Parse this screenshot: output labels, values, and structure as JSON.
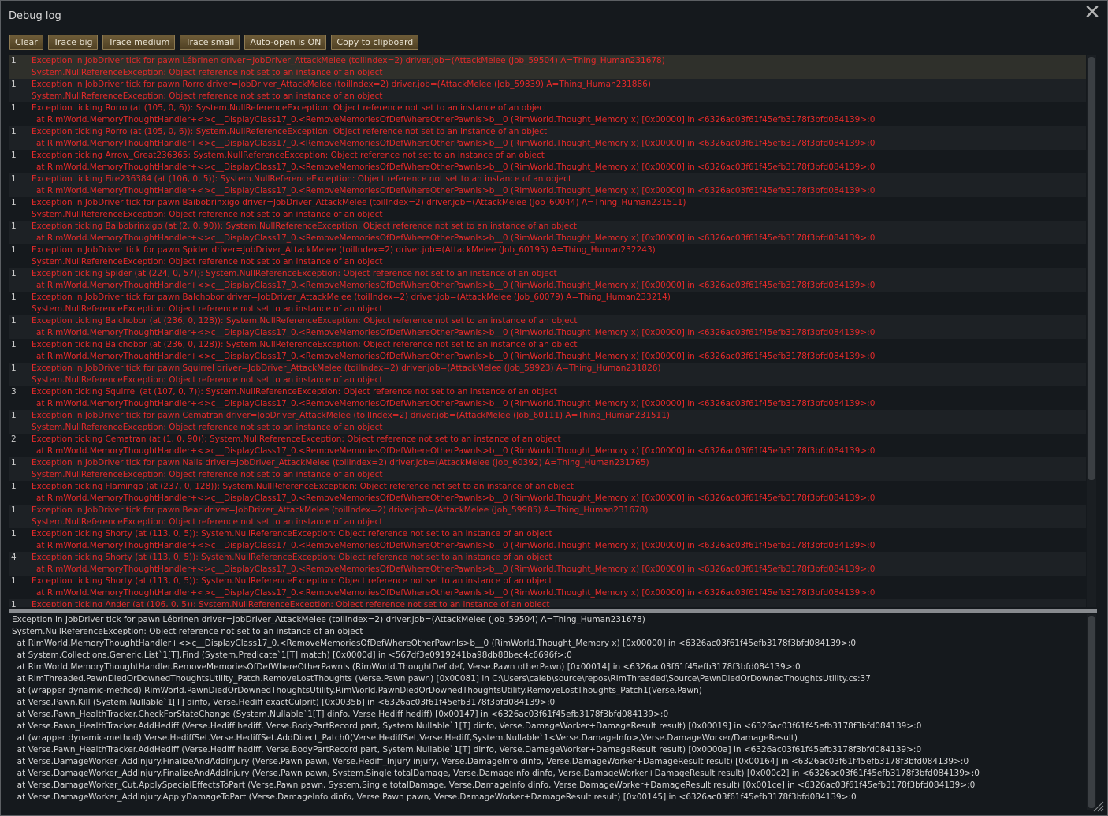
{
  "window": {
    "title": "Debug log",
    "close_glyph": "✕"
  },
  "toolbar": [
    "Clear",
    "Trace big",
    "Trace medium",
    "Trace small",
    "Auto-open is ON",
    "Copy to clipboard"
  ],
  "log_entries": [
    {
      "count": "1",
      "l1": "Exception in JobDriver tick for pawn Lébrinen driver=JobDriver_AttackMelee (toilIndex=2) driver.job=(AttackMelee (Job_59504) A=Thing_Human231678)",
      "l2": "System.NullReferenceException: Object reference not set to an instance of an object"
    },
    {
      "count": "1",
      "l1": "Exception in JobDriver tick for pawn Rorro driver=JobDriver_AttackMelee (toilIndex=2) driver.job=(AttackMelee (Job_59839) A=Thing_Human231886)",
      "l2": "System.NullReferenceException: Object reference not set to an instance of an object"
    },
    {
      "count": "1",
      "l1": "Exception ticking Rorro (at (105, 0, 6)): System.NullReferenceException: Object reference not set to an instance of an object",
      "l2": "at RimWorld.MemoryThoughtHandler+<>c__DisplayClass17_0.<RemoveMemoriesOfDefWhereOtherPawnIs>b__0 (RimWorld.Thought_Memory x) [0x00000] in <6326ac03f61f45efb3178f3bfd084139>:0",
      "indent": true
    },
    {
      "count": "1",
      "l1": "Exception ticking Rorro (at (105, 0, 6)): System.NullReferenceException: Object reference not set to an instance of an object",
      "l2": "at RimWorld.MemoryThoughtHandler+<>c__DisplayClass17_0.<RemoveMemoriesOfDefWhereOtherPawnIs>b__0 (RimWorld.Thought_Memory x) [0x00000] in <6326ac03f61f45efb3178f3bfd084139>:0",
      "indent": true
    },
    {
      "count": "1",
      "l1": "Exception ticking Arrow_Great236365: System.NullReferenceException: Object reference not set to an instance of an object",
      "l2": "at RimWorld.MemoryThoughtHandler+<>c__DisplayClass17_0.<RemoveMemoriesOfDefWhereOtherPawnIs>b__0 (RimWorld.Thought_Memory x) [0x00000] in <6326ac03f61f45efb3178f3bfd084139>:0",
      "indent": true
    },
    {
      "count": "1",
      "l1": "Exception ticking Fire236384 (at (106, 0, 5)): System.NullReferenceException: Object reference not set to an instance of an object",
      "l2": "at RimWorld.MemoryThoughtHandler+<>c__DisplayClass17_0.<RemoveMemoriesOfDefWhereOtherPawnIs>b__0 (RimWorld.Thought_Memory x) [0x00000] in <6326ac03f61f45efb3178f3bfd084139>:0",
      "indent": true
    },
    {
      "count": "1",
      "l1": "Exception in JobDriver tick for pawn Baibobrinxigo driver=JobDriver_AttackMelee (toilIndex=2) driver.job=(AttackMelee (Job_60044) A=Thing_Human231511)",
      "l2": "System.NullReferenceException: Object reference not set to an instance of an object"
    },
    {
      "count": "1",
      "l1": "Exception ticking Baibobrinxigo (at (2, 0, 90)): System.NullReferenceException: Object reference not set to an instance of an object",
      "l2": "at RimWorld.MemoryThoughtHandler+<>c__DisplayClass17_0.<RemoveMemoriesOfDefWhereOtherPawnIs>b__0 (RimWorld.Thought_Memory x) [0x00000] in <6326ac03f61f45efb3178f3bfd084139>:0",
      "indent": true
    },
    {
      "count": "1",
      "l1": "Exception in JobDriver tick for pawn Spider driver=JobDriver_AttackMelee (toilIndex=2) driver.job=(AttackMelee (Job_60195) A=Thing_Human232243)",
      "l2": "System.NullReferenceException: Object reference not set to an instance of an object"
    },
    {
      "count": "1",
      "l1": "Exception ticking Spider (at (224, 0, 57)): System.NullReferenceException: Object reference not set to an instance of an object",
      "l2": "at RimWorld.MemoryThoughtHandler+<>c__DisplayClass17_0.<RemoveMemoriesOfDefWhereOtherPawnIs>b__0 (RimWorld.Thought_Memory x) [0x00000] in <6326ac03f61f45efb3178f3bfd084139>:0",
      "indent": true
    },
    {
      "count": "1",
      "l1": "Exception in JobDriver tick for pawn Balchobor driver=JobDriver_AttackMelee (toilIndex=2) driver.job=(AttackMelee (Job_60079) A=Thing_Human233214)",
      "l2": "System.NullReferenceException: Object reference not set to an instance of an object"
    },
    {
      "count": "1",
      "l1": "Exception ticking Balchobor (at (236, 0, 128)): System.NullReferenceException: Object reference not set to an instance of an object",
      "l2": "at RimWorld.MemoryThoughtHandler+<>c__DisplayClass17_0.<RemoveMemoriesOfDefWhereOtherPawnIs>b__0 (RimWorld.Thought_Memory x) [0x00000] in <6326ac03f61f45efb3178f3bfd084139>:0",
      "indent": true
    },
    {
      "count": "1",
      "l1": "Exception ticking Balchobor (at (236, 0, 128)): System.NullReferenceException: Object reference not set to an instance of an object",
      "l2": "at RimWorld.MemoryThoughtHandler+<>c__DisplayClass17_0.<RemoveMemoriesOfDefWhereOtherPawnIs>b__0 (RimWorld.Thought_Memory x) [0x00000] in <6326ac03f61f45efb3178f3bfd084139>:0",
      "indent": true
    },
    {
      "count": "1",
      "l1": "Exception in JobDriver tick for pawn Squirrel driver=JobDriver_AttackMelee (toilIndex=2) driver.job=(AttackMelee (Job_59923) A=Thing_Human231826)",
      "l2": "System.NullReferenceException: Object reference not set to an instance of an object"
    },
    {
      "count": "3",
      "l1": "Exception ticking Squirrel (at (107, 0, 7)): System.NullReferenceException: Object reference not set to an instance of an object",
      "l2": "at RimWorld.MemoryThoughtHandler+<>c__DisplayClass17_0.<RemoveMemoriesOfDefWhereOtherPawnIs>b__0 (RimWorld.Thought_Memory x) [0x00000] in <6326ac03f61f45efb3178f3bfd084139>:0",
      "indent": true
    },
    {
      "count": "1",
      "l1": "Exception in JobDriver tick for pawn Cematran driver=JobDriver_AttackMelee (toilIndex=2) driver.job=(AttackMelee (Job_60111) A=Thing_Human231511)",
      "l2": "System.NullReferenceException: Object reference not set to an instance of an object"
    },
    {
      "count": "2",
      "l1": "Exception ticking Cematran (at (1, 0, 90)): System.NullReferenceException: Object reference not set to an instance of an object",
      "l2": "at RimWorld.MemoryThoughtHandler+<>c__DisplayClass17_0.<RemoveMemoriesOfDefWhereOtherPawnIs>b__0 (RimWorld.Thought_Memory x) [0x00000] in <6326ac03f61f45efb3178f3bfd084139>:0",
      "indent": true
    },
    {
      "count": "1",
      "l1": "Exception in JobDriver tick for pawn Nails driver=JobDriver_AttackMelee (toilIndex=2) driver.job=(AttackMelee (Job_60392) A=Thing_Human231765)",
      "l2": "System.NullReferenceException: Object reference not set to an instance of an object"
    },
    {
      "count": "1",
      "l1": "Exception ticking Flamingo (at (237, 0, 128)): System.NullReferenceException: Object reference not set to an instance of an object",
      "l2": "at RimWorld.MemoryThoughtHandler+<>c__DisplayClass17_0.<RemoveMemoriesOfDefWhereOtherPawnIs>b__0 (RimWorld.Thought_Memory x) [0x00000] in <6326ac03f61f45efb3178f3bfd084139>:0",
      "indent": true
    },
    {
      "count": "1",
      "l1": "Exception in JobDriver tick for pawn Bear driver=JobDriver_AttackMelee (toilIndex=2) driver.job=(AttackMelee (Job_59985) A=Thing_Human231678)",
      "l2": "System.NullReferenceException: Object reference not set to an instance of an object"
    },
    {
      "count": "1",
      "l1": "Exception ticking Shorty (at (113, 0, 5)): System.NullReferenceException: Object reference not set to an instance of an object",
      "l2": "at RimWorld.MemoryThoughtHandler+<>c__DisplayClass17_0.<RemoveMemoriesOfDefWhereOtherPawnIs>b__0 (RimWorld.Thought_Memory x) [0x00000] in <6326ac03f61f45efb3178f3bfd084139>:0",
      "indent": true
    },
    {
      "count": "4",
      "l1": "Exception ticking Shorty (at (113, 0, 5)): System.NullReferenceException: Object reference not set to an instance of an object",
      "l2": "at RimWorld.MemoryThoughtHandler+<>c__DisplayClass17_0.<RemoveMemoriesOfDefWhereOtherPawnIs>b__0 (RimWorld.Thought_Memory x) [0x00000] in <6326ac03f61f45efb3178f3bfd084139>:0",
      "indent": true
    },
    {
      "count": "1",
      "l1": "Exception ticking Shorty (at (113, 0, 5)): System.NullReferenceException: Object reference not set to an instance of an object",
      "l2": "at RimWorld.MemoryThoughtHandler+<>c__DisplayClass17_0.<RemoveMemoriesOfDefWhereOtherPawnIs>b__0 (RimWorld.Thought_Memory x) [0x00000] in <6326ac03f61f45efb3178f3bfd084139>:0",
      "indent": true
    },
    {
      "count": "1",
      "l1": "Exception ticking Ander (at (106, 0, 5)): System.NullReferenceException: Object reference not set to an instance of an object",
      "l2": ""
    }
  ],
  "detail_lines": [
    "Exception in JobDriver tick for pawn Lébrinen driver=JobDriver_AttackMelee (toilIndex=2) driver.job=(AttackMelee (Job_59504) A=Thing_Human231678)",
    "System.NullReferenceException: Object reference not set to an instance of an object",
    "  at RimWorld.MemoryThoughtHandler+<>c__DisplayClass17_0.<RemoveMemoriesOfDefWhereOtherPawnIs>b__0 (RimWorld.Thought_Memory x) [0x00000] in <6326ac03f61f45efb3178f3bfd084139>:0",
    "  at System.Collections.Generic.List`1[T].Find (System.Predicate`1[T] match) [0x0000d] in <567df3e0919241ba98db88bec4c6696f>:0",
    "  at RimWorld.MemoryThoughtHandler.RemoveMemoriesOfDefWhereOtherPawnIs (RimWorld.ThoughtDef def, Verse.Pawn otherPawn) [0x00014] in <6326ac03f61f45efb3178f3bfd084139>:0",
    "  at RimThreaded.PawnDiedOrDownedThoughtsUtility_Patch.RemoveLostThoughts (Verse.Pawn pawn) [0x00081] in C:\\Users\\caleb\\source\\repos\\RimThreaded\\Source\\PawnDiedOrDownedThoughtsUtility.cs:37",
    "  at (wrapper dynamic-method) RimWorld.PawnDiedOrDownedThoughtsUtility.RimWorld.PawnDiedOrDownedThoughtsUtility.RemoveLostThoughts_Patch1(Verse.Pawn)",
    "  at Verse.Pawn.Kill (System.Nullable`1[T] dinfo, Verse.Hediff exactCulprit) [0x0035b] in <6326ac03f61f45efb3178f3bfd084139>:0",
    "  at Verse.Pawn_HealthTracker.CheckForStateChange (System.Nullable`1[T] dinfo, Verse.Hediff hediff) [0x00147] in <6326ac03f61f45efb3178f3bfd084139>:0",
    "  at Verse.Pawn_HealthTracker.AddHediff (Verse.Hediff hediff, Verse.BodyPartRecord part, System.Nullable`1[T] dinfo, Verse.DamageWorker+DamageResult result) [0x00019] in <6326ac03f61f45efb3178f3bfd084139>:0",
    "  at (wrapper dynamic-method) Verse.HediffSet.Verse.HediffSet.AddDirect_Patch0(Verse.HediffSet,Verse.Hediff,System.Nullable`1<Verse.DamageInfo>,Verse.DamageWorker/DamageResult)",
    "  at Verse.Pawn_HealthTracker.AddHediff (Verse.Hediff hediff, Verse.BodyPartRecord part, System.Nullable`1[T] dinfo, Verse.DamageWorker+DamageResult result) [0x0000a] in <6326ac03f61f45efb3178f3bfd084139>:0",
    "  at Verse.DamageWorker_AddInjury.FinalizeAndAddInjury (Verse.Pawn pawn, Verse.Hediff_Injury injury, Verse.DamageInfo dinfo, Verse.DamageWorker+DamageResult result) [0x00164] in <6326ac03f61f45efb3178f3bfd084139>:0",
    "  at Verse.DamageWorker_AddInjury.FinalizeAndAddInjury (Verse.Pawn pawn, System.Single totalDamage, Verse.DamageInfo dinfo, Verse.DamageWorker+DamageResult result) [0x000c2] in <6326ac03f61f45efb3178f3bfd084139>:0",
    "  at Verse.DamageWorker_Cut.ApplySpecialEffectsToPart (Verse.Pawn pawn, System.Single totalDamage, Verse.DamageInfo dinfo, Verse.DamageWorker+DamageResult result) [0x001ce] in <6326ac03f61f45efb3178f3bfd084139>:0",
    "  at Verse.DamageWorker_AddInjury.ApplyDamageToPart (Verse.DamageInfo dinfo, Verse.Pawn pawn, Verse.DamageWorker+DamageResult result) [0x00145] in <6326ac03f61f45efb3178f3bfd084139>:0"
  ],
  "colors": {
    "error_text": "#e52a2a",
    "button_bg": "#5e4d2c",
    "window_bg": "#15191d"
  }
}
